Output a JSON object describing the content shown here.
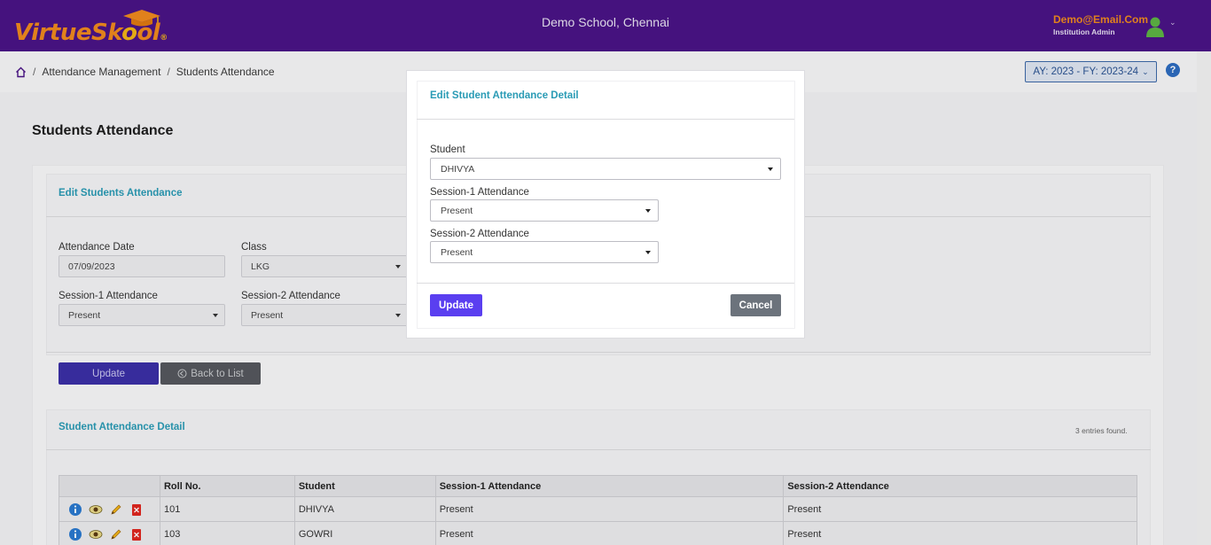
{
  "header": {
    "logo_main": "VirtueSk",
    "logo_o": "o",
    "logo_end": "ol",
    "logo_reg": "®",
    "school_name": "Demo School, Chennai",
    "user_email": "Demo@Email.Com",
    "user_role": "Institution Admin"
  },
  "breadcrumb": {
    "items": [
      "Attendance Management",
      "Students Attendance"
    ],
    "separator": "/"
  },
  "academic_year": "AY: 2023 - FY: 2023-24",
  "help_label": "?",
  "page_title": "Students Attendance",
  "edit_section": {
    "title": "Edit Students Attendance",
    "attendance_date_label": "Attendance Date",
    "attendance_date_value": "07/09/2023",
    "class_label": "Class",
    "class_value": "LKG",
    "session1_label": "Session-1 Attendance",
    "session1_value": "Present",
    "session2_label": "Session-2 Attendance",
    "session2_value": "Present",
    "update_label": "Update",
    "back_label": "Back to List"
  },
  "detail_section": {
    "title": "Student Attendance Detail",
    "entries": "3 entries found.",
    "columns": [
      "Roll No.",
      "Student",
      "Session-1 Attendance",
      "Session-2 Attendance"
    ],
    "rows": [
      {
        "roll": "101",
        "student": "DHIVYA",
        "s1": "Present",
        "s2": "Present"
      },
      {
        "roll": "103",
        "student": "GOWRI",
        "s1": "Present",
        "s2": "Present"
      }
    ]
  },
  "modal": {
    "title": "Edit Student Attendance Detail",
    "student_label": "Student",
    "student_value": "DHIVYA",
    "session1_label": "Session-1 Attendance",
    "session1_value": "Present",
    "session2_label": "Session-2 Attendance",
    "session2_value": "Present",
    "update_label": "Update",
    "cancel_label": "Cancel"
  },
  "colors": {
    "header_bg": "#4a1486",
    "accent_teal": "#2a9bb5",
    "primary_button": "#5a3ff0",
    "cancel_button": "#6c737c"
  },
  "icons": [
    "graduation-cap-icon",
    "user-avatar-icon",
    "chevron-down-icon",
    "home-icon",
    "help-icon",
    "info-icon",
    "eye-icon",
    "pencil-icon",
    "delete-icon",
    "back-arrow-icon"
  ]
}
